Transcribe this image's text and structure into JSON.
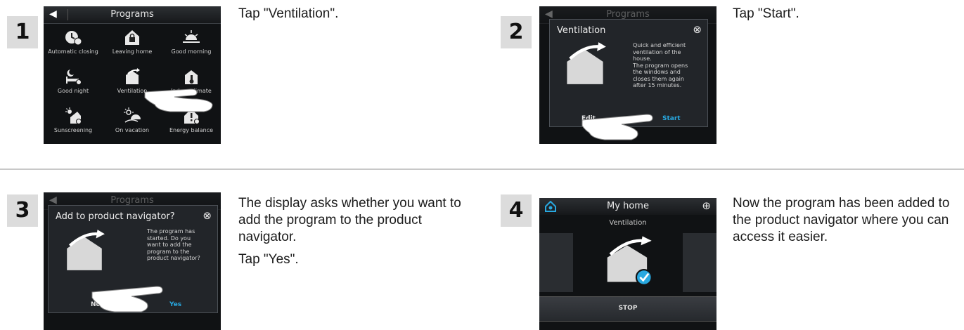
{
  "steps": [
    {
      "number": "1",
      "instruction": "Tap \"Ventilation\".",
      "screen": {
        "title": "Programs",
        "back_icon": "arrow-left-icon",
        "programs": [
          {
            "label": "Automatic closing",
            "icon": "auto-close-icon"
          },
          {
            "label": "Leaving home",
            "icon": "house-lock-icon"
          },
          {
            "label": "Good morning",
            "icon": "sunrise-icon"
          },
          {
            "label": "Good night",
            "icon": "moon-bed-icon"
          },
          {
            "label": "Ventilation",
            "icon": "house-ventilation-icon"
          },
          {
            "label": "Indoor climate",
            "icon": "thermometer-icon"
          },
          {
            "label": "Sunscreening",
            "icon": "sun-house-icon"
          },
          {
            "label": "On vacation",
            "icon": "sun-umbrella-icon"
          },
          {
            "label": "Energy balance",
            "icon": "house-energy-icon"
          }
        ]
      }
    },
    {
      "number": "2",
      "instruction": "Tap \"Start\".",
      "screen": {
        "title": "Programs",
        "dialog_title": "Ventilation",
        "dialog_text": [
          "Quick and efficient",
          "ventilation of the",
          "house.",
          "The program opens",
          "the windows and",
          "closes them again",
          "after 15 minutes."
        ],
        "left_button": "Edit",
        "right_button": "Start"
      }
    },
    {
      "number": "3",
      "instruction_lines": [
        "The display asks whether you want to add the program to the product navigator.",
        "Tap \"Yes\"."
      ],
      "screen": {
        "title": "Programs",
        "dialog_title": "Add to product navigator?",
        "dialog_text": [
          "The program has",
          "started. Do you",
          "want to add the",
          "program to the",
          "product navigator?"
        ],
        "left_button": "No",
        "right_button": "Yes"
      }
    },
    {
      "number": "4",
      "instruction": "Now the program has been added to the product navigator where you can access it easier.",
      "screen": {
        "title": "My home",
        "subtitle": "Ventilation",
        "stop_label": "STOP"
      }
    }
  ],
  "colors": {
    "accent_blue": "#28a8e0",
    "badge_bg": "#dcdcdc",
    "screen_bg": "#101214",
    "divider": "#c8c8c8"
  }
}
